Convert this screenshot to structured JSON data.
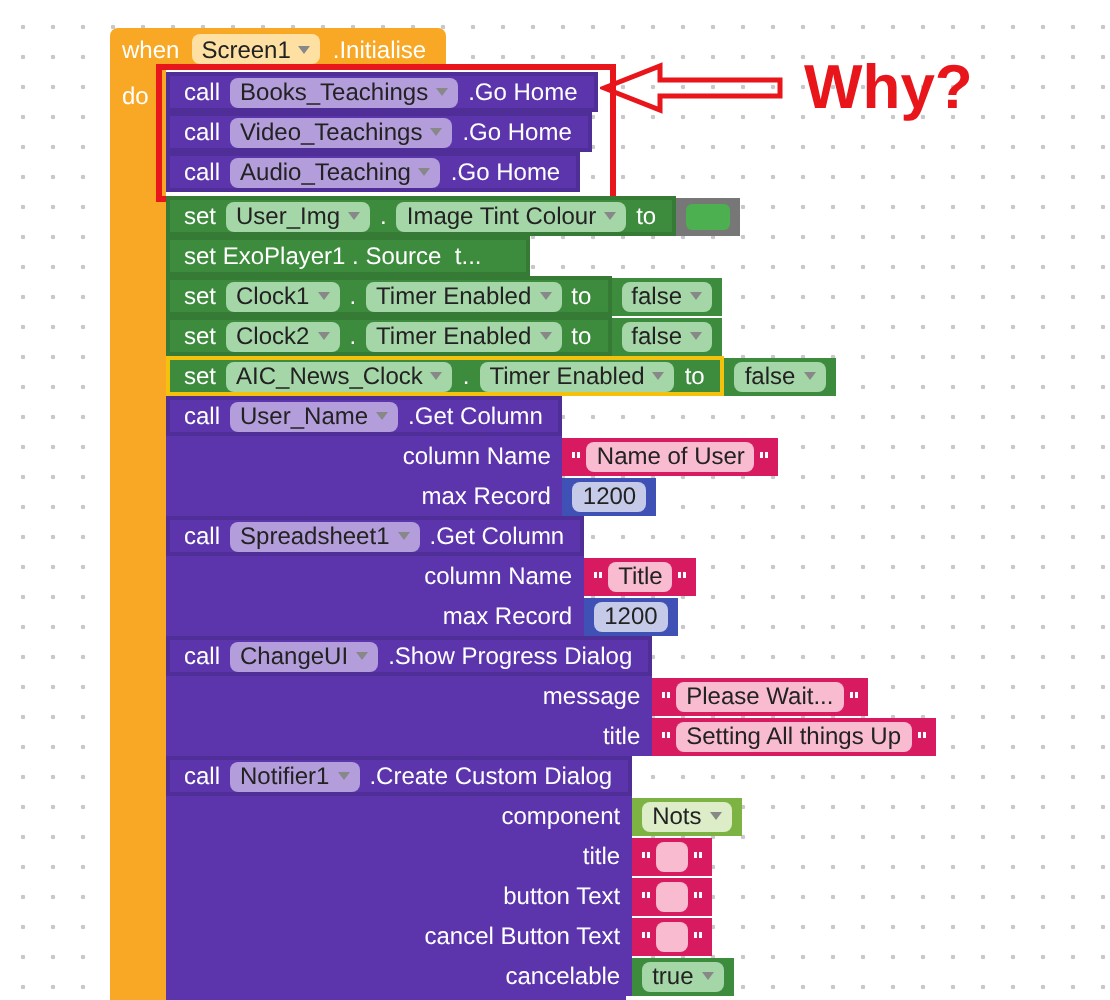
{
  "event": {
    "keyword": "when",
    "component": "Screen1",
    "event": ".Initialise",
    "do_label": "do",
    "statements": [
      {
        "kind": "highlight_group",
        "statements": [
          {
            "kind": "call",
            "keyword": "call",
            "component": "Books_Teachings",
            "method": ".Go Home",
            "selected": false
          },
          {
            "kind": "call",
            "keyword": "call",
            "component": "Video_Teachings",
            "method": ".Go Home",
            "selected": false
          },
          {
            "kind": "call",
            "keyword": "call",
            "component": "Audio_Teaching",
            "method": ".Go Home",
            "selected": false
          }
        ]
      },
      {
        "kind": "set",
        "keyword": "set",
        "component": "User_Img",
        "dot": ".",
        "property": "Image Tint Colour",
        "to": "to",
        "selected": false,
        "value": {
          "kind": "color",
          "color": "#4caf50"
        }
      },
      {
        "kind": "collapsed",
        "text": "set ExoPlayer1 . Source  t...",
        "selected": false
      },
      {
        "kind": "set",
        "keyword": "set",
        "component": "Clock1",
        "dot": ".",
        "property": "Timer Enabled",
        "to": "to",
        "selected": false,
        "value": {
          "kind": "dropdown",
          "text": "false"
        }
      },
      {
        "kind": "set",
        "keyword": "set",
        "component": "Clock2",
        "dot": ".",
        "property": "Timer Enabled",
        "to": "to",
        "selected": false,
        "value": {
          "kind": "dropdown",
          "text": "false"
        }
      },
      {
        "kind": "set",
        "keyword": "set",
        "component": "AIC_News_Clock",
        "dot": ".",
        "property": "Timer Enabled",
        "to": "to",
        "selected": true,
        "value": {
          "kind": "dropdown",
          "text": "false"
        }
      },
      {
        "kind": "call",
        "keyword": "call",
        "component": "User_Name",
        "method": ".Get Column",
        "selected": false,
        "args": [
          {
            "label": "column Name",
            "value": {
              "kind": "text",
              "text": "Name of User"
            }
          },
          {
            "label": "max Record",
            "value": {
              "kind": "number",
              "text": "1200"
            }
          }
        ]
      },
      {
        "kind": "call",
        "keyword": "call",
        "component": "Spreadsheet1",
        "method": ".Get Column",
        "selected": false,
        "args": [
          {
            "label": "column Name",
            "value": {
              "kind": "text",
              "text": "Title"
            }
          },
          {
            "label": "max Record",
            "value": {
              "kind": "number",
              "text": "1200"
            }
          }
        ]
      },
      {
        "kind": "call",
        "keyword": "call",
        "component": "ChangeUI",
        "method": ".Show Progress Dialog",
        "selected": false,
        "args": [
          {
            "label": "message",
            "value": {
              "kind": "text",
              "text": "Please Wait..."
            }
          },
          {
            "label": "title",
            "value": {
              "kind": "text",
              "text": "Setting All things Up"
            }
          }
        ]
      },
      {
        "kind": "call",
        "keyword": "call",
        "component": "Notifier1",
        "method": ".Create Custom Dialog",
        "selected": false,
        "args": [
          {
            "label": "component",
            "value": {
              "kind": "component",
              "text": "Nots"
            }
          },
          {
            "label": "title",
            "value": {
              "kind": "text"
            }
          },
          {
            "label": "button Text",
            "value": {
              "kind": "text"
            }
          },
          {
            "label": "cancel Button Text",
            "value": {
              "kind": "text"
            }
          },
          {
            "label": "cancelable",
            "value": {
              "kind": "dropdown",
              "text": "true"
            }
          }
        ]
      },
      {
        "kind": "cut",
        "selected": false
      }
    ]
  },
  "annotation": {
    "label": "Why?"
  }
}
